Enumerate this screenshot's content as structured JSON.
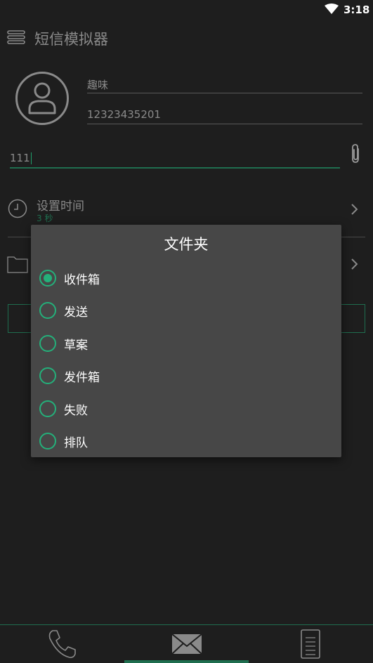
{
  "status_bar": {
    "time": "3:18",
    "wifi_icon": "wifi-icon"
  },
  "toolbar": {
    "title": "短信模拟器",
    "menu_icon": "menu-icon"
  },
  "contact": {
    "name": "趣味",
    "phone": "12323435201"
  },
  "message": {
    "text": "111"
  },
  "schedule": {
    "title": "设置时间",
    "subtitle": "3 秒"
  },
  "dialog": {
    "title": "文件夹",
    "options": [
      {
        "label": "收件箱",
        "selected": true
      },
      {
        "label": "发送",
        "selected": false
      },
      {
        "label": "草案",
        "selected": false
      },
      {
        "label": "发件箱",
        "selected": false
      },
      {
        "label": "失败",
        "selected": false
      },
      {
        "label": "排队",
        "selected": false
      }
    ]
  },
  "bottom_nav": {
    "items": [
      "phone-icon",
      "mail-icon",
      "document-icon"
    ],
    "active_index": 1
  },
  "colors": {
    "accent": "#24b07a",
    "accent_dark": "#1f6e4f",
    "background": "#1e1e1e",
    "dialog": "#474747"
  }
}
